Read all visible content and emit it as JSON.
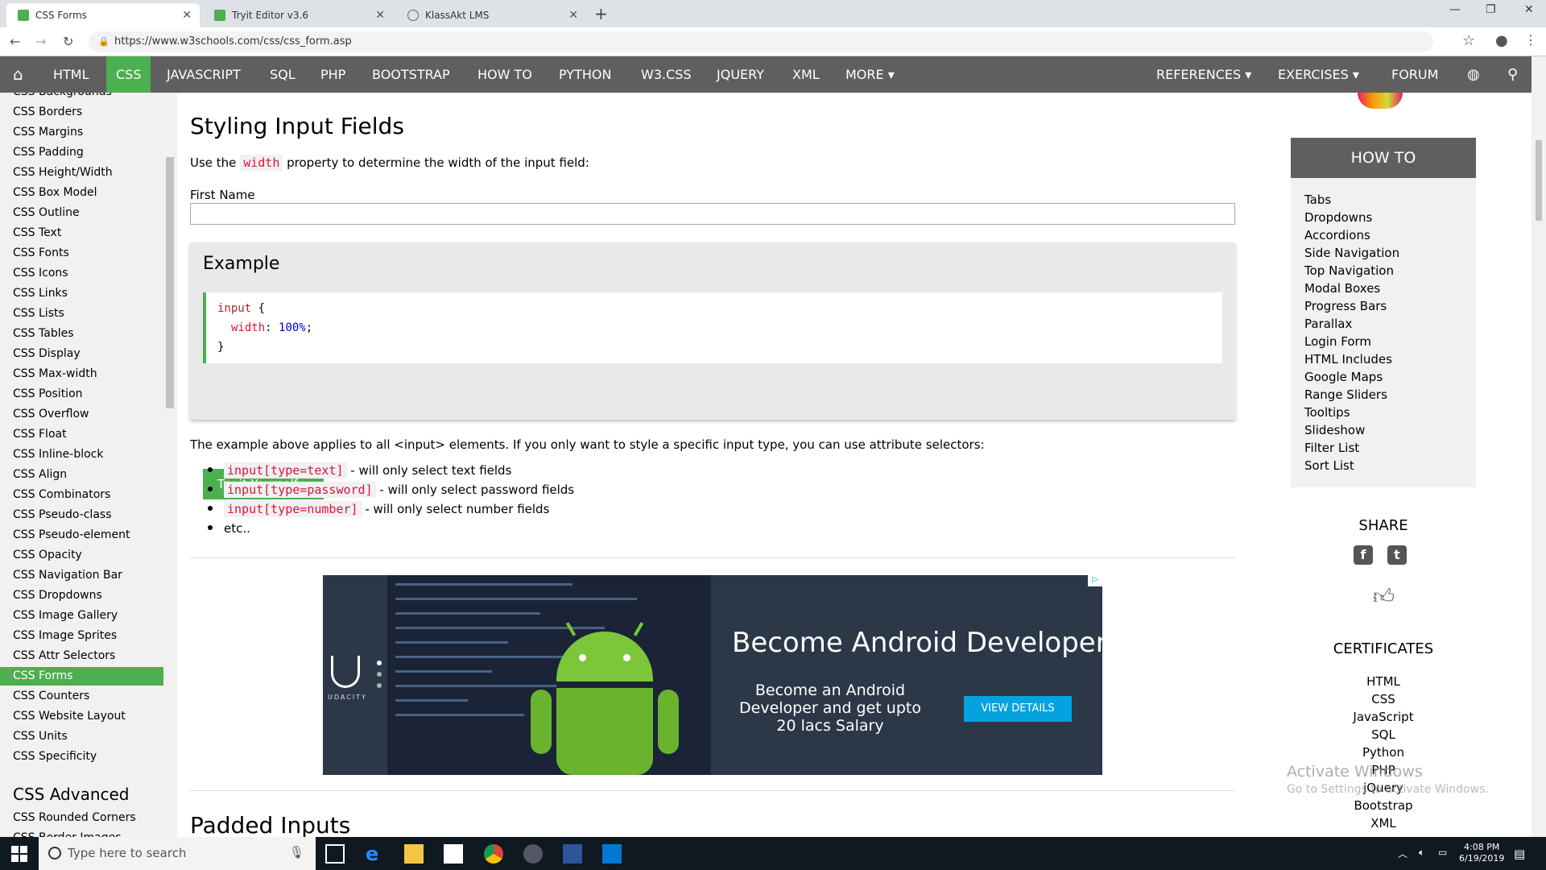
{
  "browser": {
    "tabs": [
      {
        "title": "CSS Forms",
        "active": true
      },
      {
        "title": "Tryit Editor v3.6",
        "active": false
      },
      {
        "title": "KlassAkt LMS",
        "active": false
      }
    ],
    "url": "https://www.w3schools.com/css/css_form.asp"
  },
  "topnav": {
    "items": [
      "HTML",
      "CSS",
      "JAVASCRIPT",
      "SQL",
      "PHP",
      "BOOTSTRAP",
      "HOW TO",
      "PYTHON",
      "W3.CSS",
      "JQUERY",
      "XML",
      "MORE ▾"
    ],
    "active": "CSS",
    "right_items": [
      "REFERENCES ▾",
      "EXERCISES ▾",
      "FORUM"
    ]
  },
  "sidebar": {
    "items": [
      "CSS Backgrounds",
      "CSS Borders",
      "CSS Margins",
      "CSS Padding",
      "CSS Height/Width",
      "CSS Box Model",
      "CSS Outline",
      "CSS Text",
      "CSS Fonts",
      "CSS Icons",
      "CSS Links",
      "CSS Lists",
      "CSS Tables",
      "CSS Display",
      "CSS Max-width",
      "CSS Position",
      "CSS Overflow",
      "CSS Float",
      "CSS Inline-block",
      "CSS Align",
      "CSS Combinators",
      "CSS Pseudo-class",
      "CSS Pseudo-element",
      "CSS Opacity",
      "CSS Navigation Bar",
      "CSS Dropdowns",
      "CSS Image Gallery",
      "CSS Image Sprites",
      "CSS Attr Selectors",
      "CSS Forms",
      "CSS Counters",
      "CSS Website Layout",
      "CSS Units",
      "CSS Specificity"
    ],
    "active": "CSS Forms",
    "section_heading": "CSS Advanced",
    "advanced_items": [
      "CSS Rounded Corners",
      "CSS Border Images"
    ]
  },
  "main": {
    "heading": "Styling Input Fields",
    "intro_before": "Use the",
    "intro_code": "width",
    "intro_after": "property to determine the width of the input field:",
    "field_label": "First Name",
    "example": {
      "heading": "Example",
      "code": {
        "selector": "input",
        "brace_open": " {",
        "prop": "width",
        "colon": ": ",
        "value": "100%",
        "semi": ";",
        "brace_close": "}"
      },
      "button": "Try it Yourself »"
    },
    "paragraph": "The example above applies to all <input> elements. If you only want to style a specific input type, you can use attribute selectors:",
    "bullets": [
      {
        "code": "input[type=text]",
        "text": "- will only select text fields"
      },
      {
        "code": "input[type=password]",
        "text": "- will only select password fields"
      },
      {
        "code": "input[type=number]",
        "text": "- will only select number fields"
      },
      {
        "code": "",
        "text": "etc.."
      }
    ],
    "next_heading": "Padded Inputs"
  },
  "ad": {
    "brand": "UDACITY",
    "title": "Become Android Developer",
    "subtitle": "Become an Android Developer and get upto 20 lacs Salary",
    "button": "VIEW DETAILS"
  },
  "right": {
    "howto_heading": "HOW TO",
    "howto_items": [
      "Tabs",
      "Dropdowns",
      "Accordions",
      "Side Navigation",
      "Top Navigation",
      "Modal Boxes",
      "Progress Bars",
      "Parallax",
      "Login Form",
      "HTML Includes",
      "Google Maps",
      "Range Sliders",
      "Tooltips",
      "Slideshow",
      "Filter List",
      "Sort List"
    ],
    "share_heading": "SHARE",
    "certs_heading": "CERTIFICATES",
    "certs": [
      "HTML",
      "CSS",
      "JavaScript",
      "SQL",
      "Python",
      "PHP",
      "jQuery",
      "Bootstrap",
      "XML"
    ]
  },
  "watermark": {
    "line1": "Activate Windows",
    "line2": "Go to Settings to activate Windows."
  },
  "taskbar": {
    "search_placeholder": "Type here to search",
    "time": "4:08 PM",
    "date": "6/19/2019"
  },
  "colors": {
    "accent": "#4caf50",
    "nav": "#5f5f5f",
    "code_red": "#dc143c",
    "ad_button": "#02a3de"
  }
}
